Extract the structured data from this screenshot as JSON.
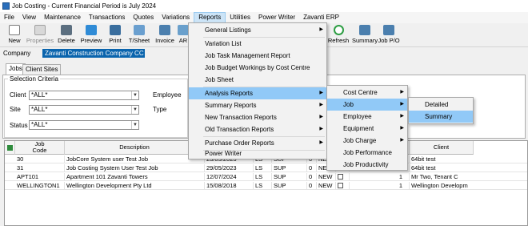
{
  "window": {
    "title": "Job Costing - Current Financial Period is July 2024"
  },
  "menubar": [
    "File",
    "View",
    "Maintenance",
    "Transactions",
    "Quotes",
    "Variations",
    "Reports",
    "Utilities",
    "Power Writer",
    "Zavanti ERP"
  ],
  "toolbar": {
    "new": "New",
    "properties": "Properties",
    "delete": "Delete",
    "preview": "Preview",
    "print": "Print",
    "tsheet": "T/Sheet",
    "invoice": "Invoice",
    "ar": "AR",
    "refresh": "Refresh",
    "summary": "Summary",
    "jobpo": "Job P/O"
  },
  "company": {
    "label": "Company",
    "value": "Zavanti Construction Company CC Level"
  },
  "tabs": {
    "jobs": "Jobs",
    "client_sites": "Client Sites"
  },
  "criteria": {
    "title": "Selection Criteria",
    "client_label": "Client",
    "client_value": "*ALL*",
    "site_label": "Site",
    "site_value": "*ALL*",
    "status_label": "Status",
    "status_value": "*ALL*",
    "employee_label": "Employee",
    "type_label": "Type"
  },
  "grid": {
    "headers": {
      "job_code": "Job\nCode",
      "description": "Description",
      "client": "Client"
    },
    "rows": [
      {
        "code": "30",
        "description": "JobCore System user Test Job",
        "date": "23/05/2023",
        "c1": "LS",
        "c2": "SUP",
        "c3": "0",
        "status": "NEW",
        "n": "1",
        "client": "64bit test"
      },
      {
        "code": "31",
        "description": "Job Costing System User Test Job",
        "date": "29/05/2023",
        "c1": "LS",
        "c2": "SUP",
        "c3": "0",
        "status": "NEW",
        "n": "1",
        "client": "64bit test"
      },
      {
        "code": "APT101",
        "description": "Apartment 101 Zavanti Towers",
        "date": "12/07/2024",
        "c1": "LS",
        "c2": "SUP",
        "c3": "0",
        "status": "NEW",
        "n": "1",
        "client": "Mr Two, Tenant C"
      },
      {
        "code": "WELLINGTON1",
        "description": "Wellington Development Pty Ltd",
        "date": "15/08/2018",
        "c1": "LS",
        "c2": "SUP",
        "c3": "0",
        "status": "NEW",
        "n": "1",
        "client": "Wellington Developm"
      }
    ]
  },
  "reports_menu": [
    "General Listings",
    "Variation List",
    "Job Task Management Report",
    "Job Budget Workings by Cost Centre",
    "Job Sheet",
    "Analysis Reports",
    "Summary Reports",
    "New Transaction Reports",
    "Old Transaction Reports",
    "Purchase Order Reports",
    "Power Writer"
  ],
  "analysis_menu": [
    "Cost Centre",
    "Job",
    "Employee",
    "Equipment",
    "Job Charge",
    "Job Performance",
    "Job Productivity"
  ],
  "job_menu": [
    "Detailed",
    "Summary"
  ],
  "colors": {
    "highlight": "#91c9f7",
    "selection": "#0a64ad"
  }
}
